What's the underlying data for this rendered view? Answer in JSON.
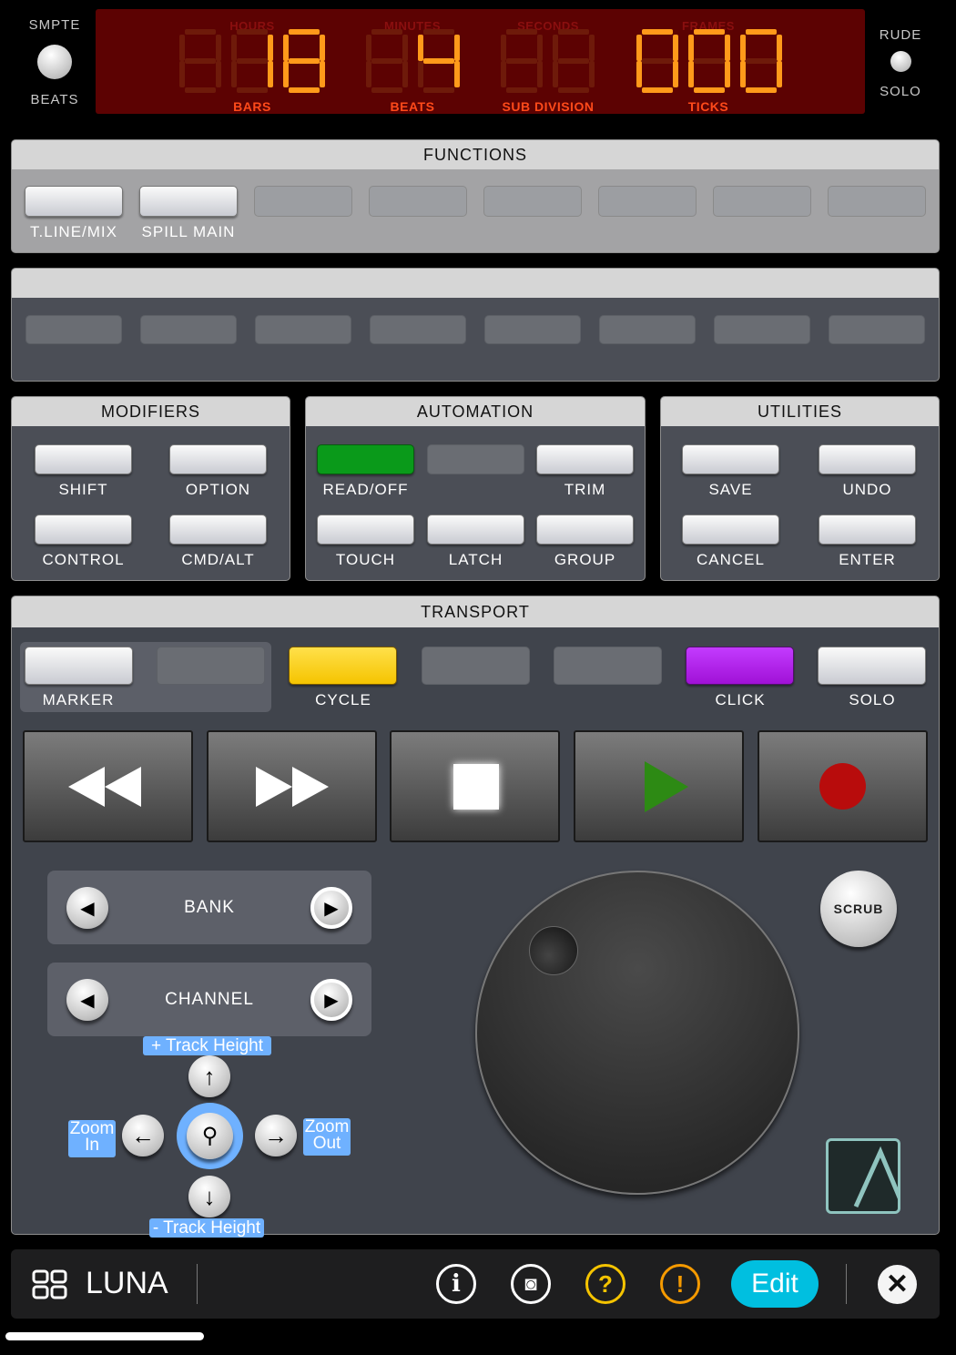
{
  "header": {
    "smpte_label": "SMPTE",
    "beats_label": "BEATS",
    "rude_label": "RUDE",
    "solo_label": "SOLO"
  },
  "display": {
    "top_labels": [
      "HOURS",
      "MINUTES",
      "SECONDS",
      "FRAMES"
    ],
    "bottom_labels": [
      "BARS",
      "BEATS",
      "SUB DIVISION",
      "TICKS"
    ],
    "bars": "18",
    "beats": "4",
    "sub_division": "",
    "ticks": "000",
    "lit_color": "#ff9a1a",
    "unlit_color": "#6e1a0a"
  },
  "functions": {
    "title": "FUNCTIONS",
    "buttons": [
      "T.LINE/MIX",
      "SPILL MAIN",
      "",
      "",
      "",
      "",
      "",
      ""
    ]
  },
  "modifiers": {
    "title": "MODIFIERS",
    "buttons": [
      "SHIFT",
      "OPTION",
      "CONTROL",
      "CMD/ALT"
    ]
  },
  "automation": {
    "title": "AUTOMATION",
    "buttons": [
      "READ/OFF",
      "",
      "TRIM",
      "TOUCH",
      "LATCH",
      "GROUP"
    ],
    "active": "READ/OFF",
    "active_color": "#0a9a1a"
  },
  "utilities": {
    "title": "UTILITIES",
    "buttons": [
      "SAVE",
      "UNDO",
      "CANCEL",
      "ENTER"
    ]
  },
  "transport": {
    "title": "TRANSPORT",
    "buttons": [
      "MARKER",
      "",
      "CYCLE",
      "",
      "",
      "CLICK",
      "SOLO"
    ],
    "cycle_color": "#f5c400",
    "click_color": "#a011d6",
    "bank_label": "BANK",
    "channel_label": "CHANNEL",
    "scrub_label": "SCRUB",
    "track_height_plus": "+ Track Height",
    "track_height_minus": "- Track Height",
    "zoom_in": "Zoom In",
    "zoom_out": "Zoom Out"
  },
  "bottom_bar": {
    "app_name": "LUNA",
    "edit_label": "Edit",
    "edit_color": "#00bfe0"
  }
}
